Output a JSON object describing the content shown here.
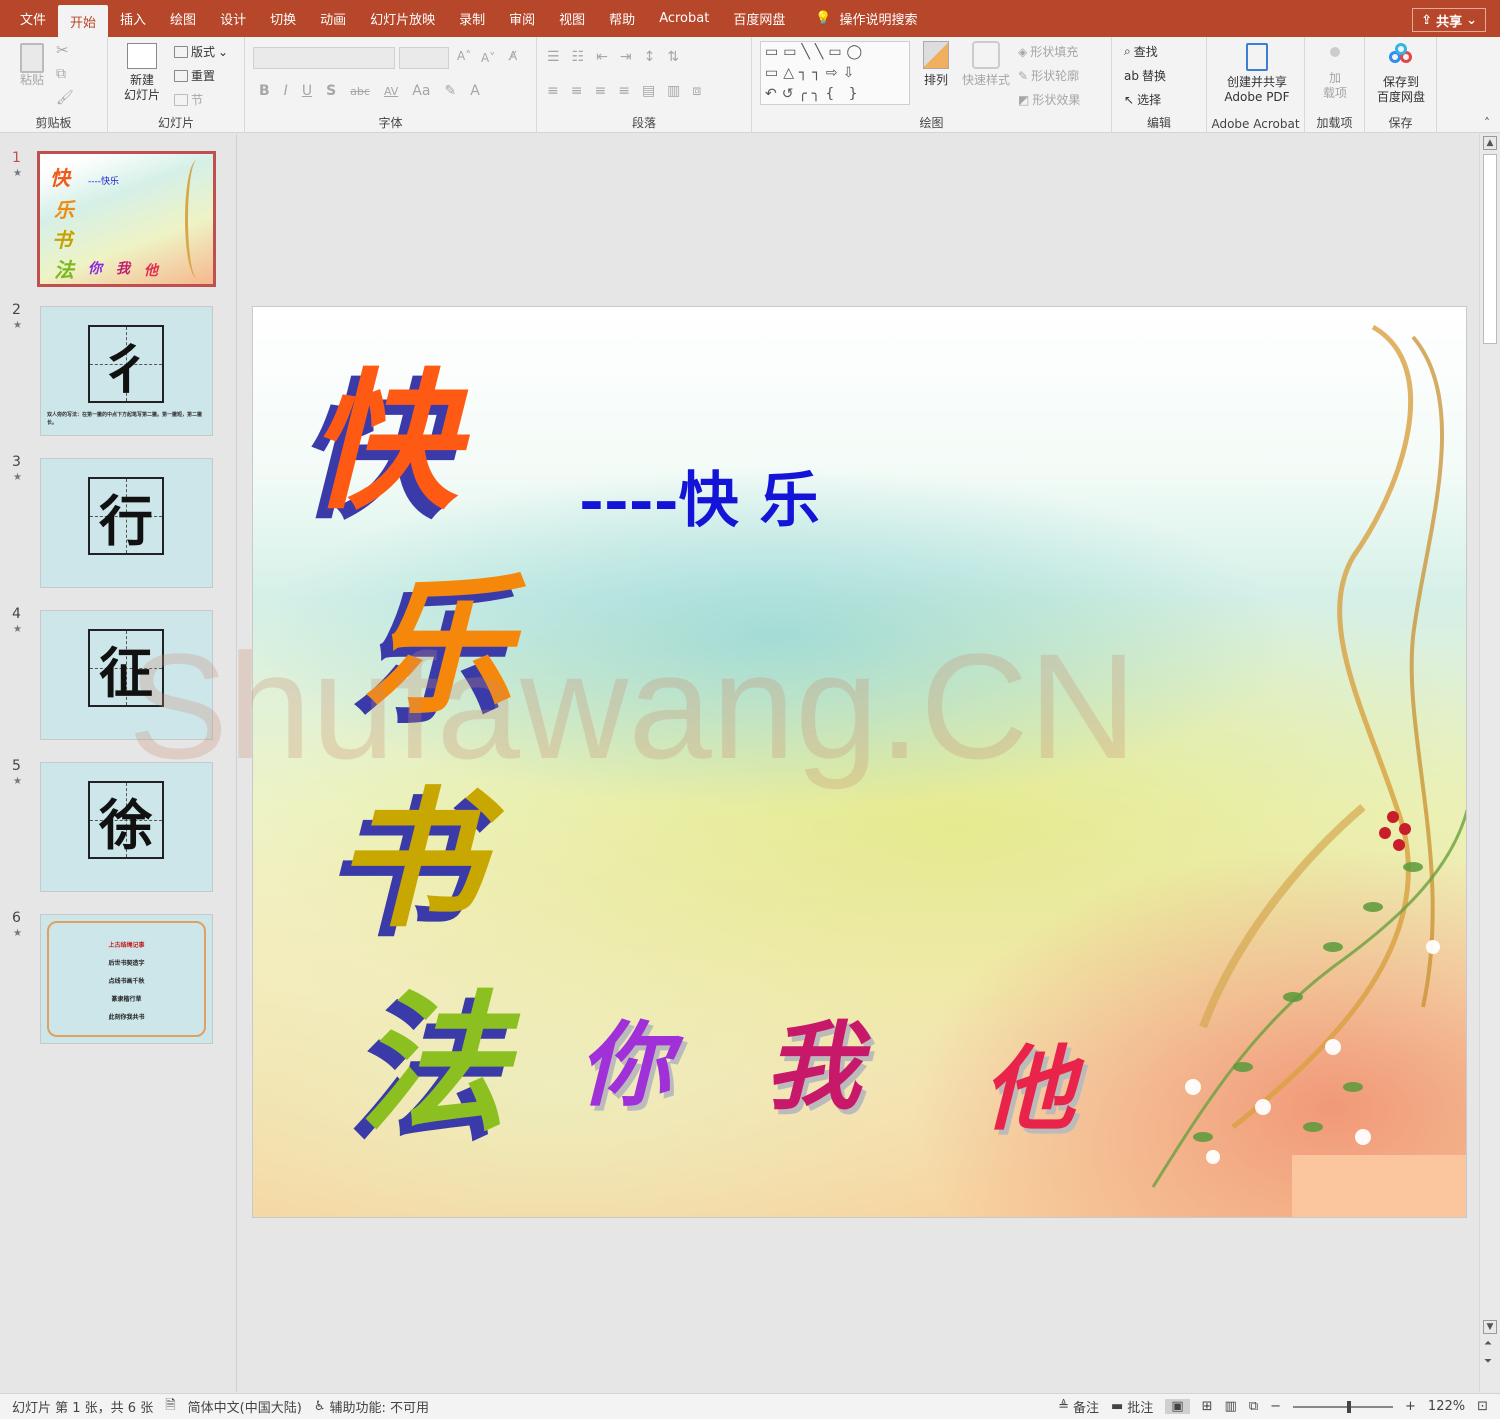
{
  "menu": {
    "tabs": [
      "文件",
      "开始",
      "插入",
      "绘图",
      "设计",
      "切换",
      "动画",
      "幻灯片放映",
      "录制",
      "审阅",
      "视图",
      "帮助",
      "Acrobat",
      "百度网盘"
    ],
    "active": "开始",
    "tellme": "操作说明搜索",
    "share": "共享"
  },
  "ribbon": {
    "clipboard": {
      "paste": "粘贴",
      "label": "剪贴板"
    },
    "slides": {
      "new_slide_1": "新建",
      "new_slide_2": "幻灯片",
      "layout": "版式",
      "reset": "重置",
      "section": "节",
      "label": "幻灯片"
    },
    "font": {
      "label": "字体",
      "bold": "B",
      "italic": "I",
      "underline": "U",
      "shadow": "S",
      "strike": "abc",
      "spacing": "AV",
      "case": "Aa"
    },
    "paragraph": {
      "label": "段落"
    },
    "drawing": {
      "arrange": "排列",
      "quick_styles": "快速样式",
      "shape_fill": "形状填充",
      "shape_outline": "形状轮廓",
      "shape_effects": "形状效果",
      "label": "绘图"
    },
    "editing": {
      "find": "查找",
      "replace": "替换",
      "select": "选择",
      "label": "编辑"
    },
    "acrobat": {
      "create_1": "创建并共享",
      "create_2": "Adobe PDF",
      "label": "Adobe Acrobat"
    },
    "addins": {
      "btn_1": "加",
      "btn_2": "载项",
      "label": "加载项"
    },
    "save": {
      "btn_1": "保存到",
      "btn_2": "百度网盘",
      "label": "保存"
    }
  },
  "thumbnails": [
    {
      "num": "1",
      "chars": [
        "快",
        "乐",
        "书",
        "法"
      ],
      "subtitle": "----快乐",
      "bottom": [
        "你",
        "我",
        "他"
      ]
    },
    {
      "num": "2",
      "char": "彳",
      "note": "双人旁的写法：在第一撇的中点下方起笔写第二撇。第一撇短，第二撇长。"
    },
    {
      "num": "3",
      "char": "行"
    },
    {
      "num": "4",
      "char": "征"
    },
    {
      "num": "5",
      "char": "徐"
    },
    {
      "num": "6",
      "lines": [
        "上古结绳记事",
        "后世书契造字",
        "点线书画千秋",
        "篆隶楷行草",
        "此刻你我共书"
      ]
    }
  ],
  "slide": {
    "chars": [
      "快",
      "乐",
      "书",
      "法"
    ],
    "subtitle": "----快 乐",
    "bottom": [
      "你",
      "我",
      "他"
    ],
    "watermark": "Shufawang.CN"
  },
  "status": {
    "slide_info": "幻灯片 第 1 张，共 6 张",
    "language": "简体中文(中国大陆)",
    "accessibility": "辅助功能: 不可用",
    "notes": "备注",
    "comments": "批注",
    "zoom": "122%"
  }
}
